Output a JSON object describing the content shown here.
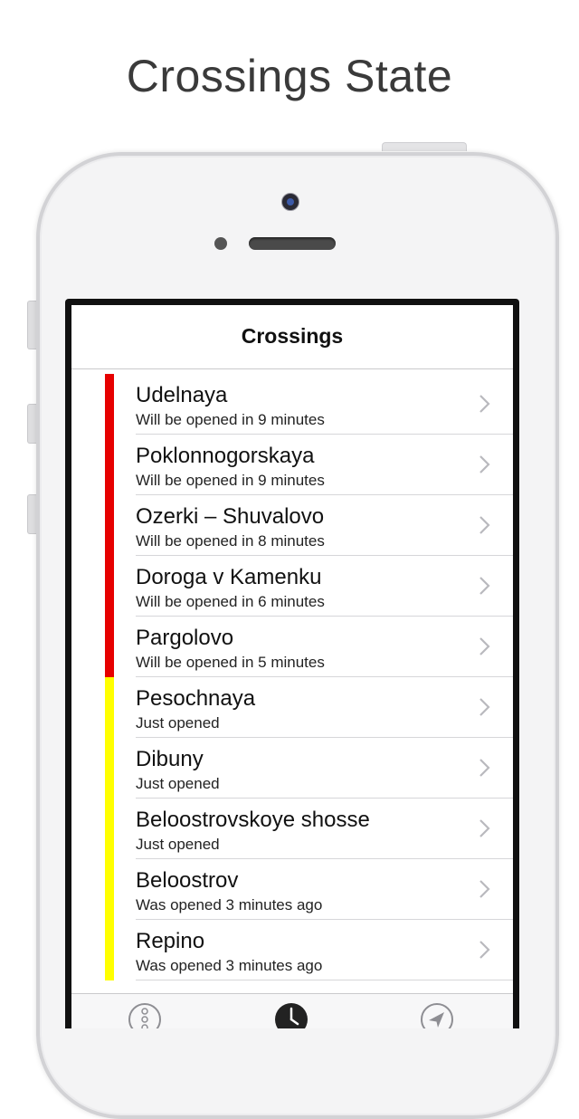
{
  "page": {
    "headline": "Crossings State"
  },
  "navbar": {
    "title": "Crossings"
  },
  "colors": {
    "closed": "#e60000",
    "opened": "#ffff00",
    "chevron": "#b9b9be"
  },
  "crossings": [
    {
      "name": "Udelnaya",
      "status": "Will be opened in 9 minutes",
      "state": "closed"
    },
    {
      "name": "Poklonnogorskaya",
      "status": "Will be opened in 9 minutes",
      "state": "closed"
    },
    {
      "name": "Ozerki – Shuvalovo",
      "status": "Will be opened in 8 minutes",
      "state": "closed"
    },
    {
      "name": "Doroga v Kamenku",
      "status": "Will be opened in 6 minutes",
      "state": "closed"
    },
    {
      "name": "Pargolovo",
      "status": "Will be opened in 5 minutes",
      "state": "closed"
    },
    {
      "name": "Pesochnaya",
      "status": "Just opened",
      "state": "opened"
    },
    {
      "name": "Dibuny",
      "status": "Just opened",
      "state": "opened"
    },
    {
      "name": "Beloostrovskoye shosse",
      "status": "Just opened",
      "state": "opened"
    },
    {
      "name": "Beloostrov",
      "status": "Was opened 3 minutes ago",
      "state": "opened"
    },
    {
      "name": "Repino",
      "status": "Was opened 3 minutes ago",
      "state": "opened"
    }
  ],
  "tabbar": {
    "tabs": [
      {
        "icon": "traffic-light-icon",
        "active": false
      },
      {
        "icon": "clock-icon",
        "active": true
      },
      {
        "icon": "location-arrow-icon",
        "active": false
      }
    ]
  }
}
